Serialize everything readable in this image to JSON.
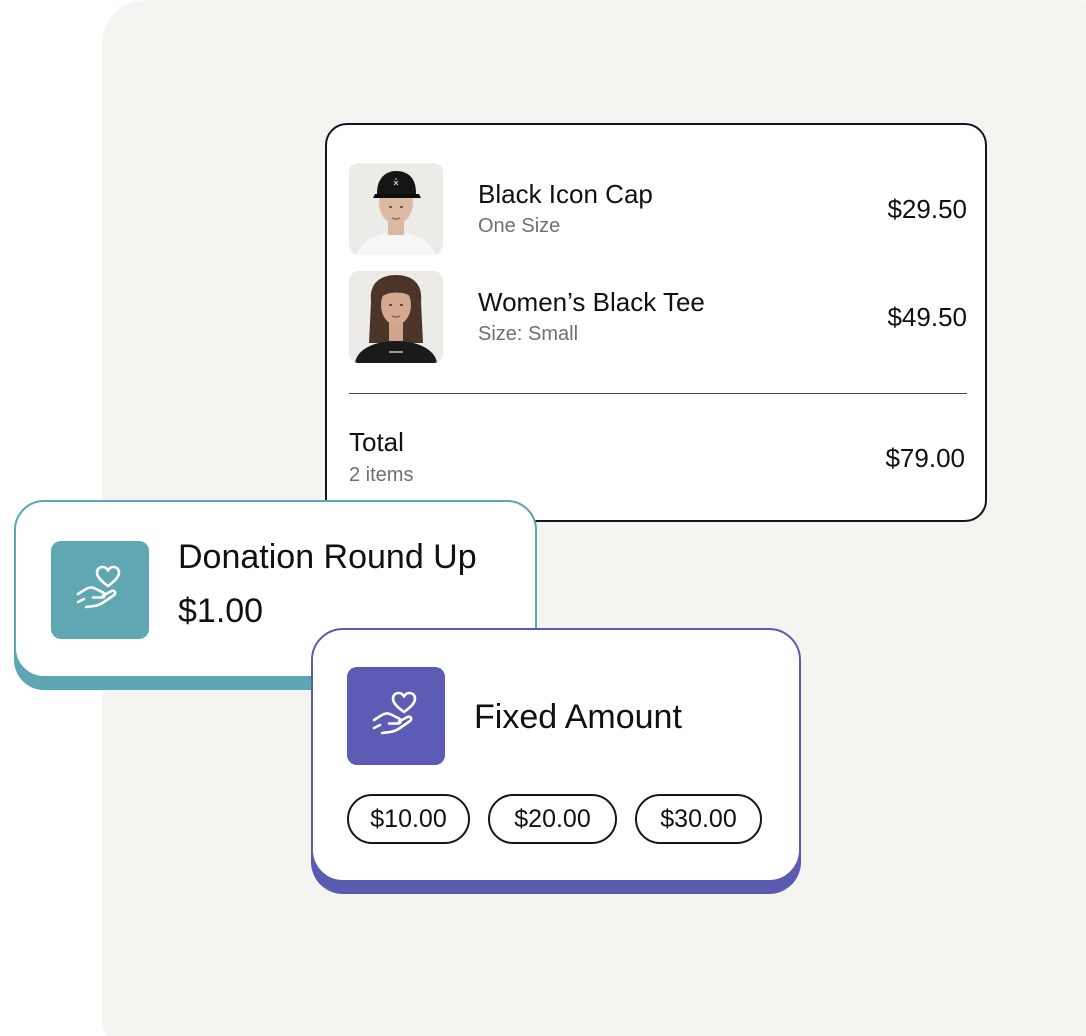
{
  "cart": {
    "items": [
      {
        "name": "Black Icon Cap",
        "detail": "One Size",
        "price": "$29.50",
        "image_icon": "model-wearing-black-cap"
      },
      {
        "name": "Women’s Black Tee",
        "detail": "Size: Small",
        "price": "$49.50",
        "image_icon": "model-wearing-black-tee"
      }
    ],
    "total": {
      "label": "Total",
      "count": "2 items",
      "price": "$79.00"
    }
  },
  "roundup": {
    "title": "Donation Round Up",
    "amount": "$1.00",
    "icon": "hand-heart-icon",
    "accent": "#5fa7b3"
  },
  "fixed": {
    "title": "Fixed Amount",
    "icon": "hand-heart-icon",
    "accent": "#5c5cb4",
    "options": [
      "$10.00",
      "$20.00",
      "$30.00"
    ]
  },
  "colors": {
    "backdrop": "#f5f4f1",
    "card_border": "#15151f",
    "muted_text": "#707070"
  }
}
